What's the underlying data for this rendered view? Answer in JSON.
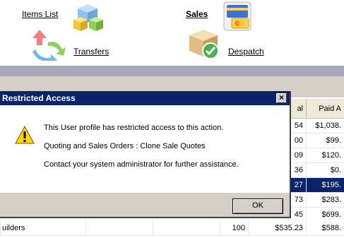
{
  "nav": {
    "items_list": "Items List",
    "sales": "Sales",
    "transfers": "Transfers",
    "despatch": "Despatch"
  },
  "grid": {
    "headers": [
      "al",
      "Paid A"
    ],
    "rows": [
      [
        "54",
        "$1,038."
      ],
      [
        "00",
        "$99."
      ],
      [
        "09",
        "$120."
      ],
      [
        "36",
        "$0."
      ],
      [
        "27",
        "$195."
      ],
      [
        "73",
        "$283."
      ],
      [
        "45",
        "$699."
      ]
    ],
    "selected_row": 4,
    "last_row": {
      "name": "uilders",
      "qty": "100",
      "total": "$535.23",
      "paid": "$588."
    }
  },
  "dialog": {
    "title": "Restricted Access",
    "close": "×",
    "line1": "This User profile has restricted access to this action.",
    "line2": "Quoting and Sales Orders : Clone Sale Quotes",
    "line3": "Contact your system administrator for further assistance.",
    "ok": "OK"
  }
}
